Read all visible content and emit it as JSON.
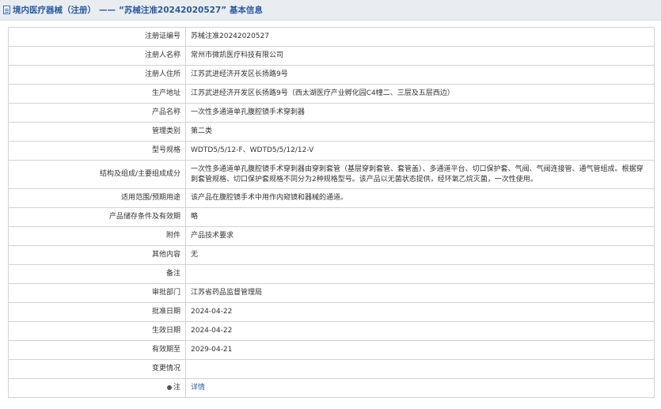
{
  "header": {
    "category": "境内医疗器械（注册）",
    "separator": "——",
    "reg_no_quoted": "“苏械注准20242020527”",
    "suffix": "基本信息"
  },
  "rows": [
    {
      "label": "注册证编号",
      "value": "苏械注准20242020527"
    },
    {
      "label": "注册人名称",
      "value": "常州市微凯医疗科技有限公司"
    },
    {
      "label": "注册人住所",
      "value": "江苏武进经济开发区长扬路9号"
    },
    {
      "label": "生产地址",
      "value": "江苏武进经济开发区长扬路9号（西太湖医疗产业孵化园C4幢二、三层及五层西边）"
    },
    {
      "label": "产品名称",
      "value": "一次性多通道单孔腹腔镜手术穿刺器"
    },
    {
      "label": "管理类别",
      "value": "第二类"
    },
    {
      "label": "型号规格",
      "value": "WDTD5/5/12-F、WDTD5/5/12/12-V"
    },
    {
      "label": "结构及组成/主要组成成分",
      "value": "一次性多通道单孔腹腔镜手术穿刺器由穿刺套管（基层穿刺套管、套管盖）、多通道平台、切口保护套、气阀、气阀连接管、通气管组成。根据穿刺套管规格、切口保护套规格不同分为2种规格型号。该产品以无菌状态提供，经环氧乙烷灭菌，一次性使用。"
    },
    {
      "label": "适用范围/预期用途",
      "value": "该产品在腹腔镜手术中用作内窥镜和器械的通道。"
    },
    {
      "label": "产品储存条件及有效期",
      "value": "略"
    },
    {
      "label": "附件",
      "value": "产品技术要求"
    },
    {
      "label": "其他内容",
      "value": "无"
    },
    {
      "label": "备注",
      "value": ""
    },
    {
      "label": "审批部门",
      "value": "江苏省药品监督管理局"
    },
    {
      "label": "批准日期",
      "value": "2024-04-22"
    },
    {
      "label": "生效日期",
      "value": "2024-04-22"
    },
    {
      "label": "有效期至",
      "value": "2029-04-21"
    },
    {
      "label": "变更情况",
      "value": ""
    }
  ],
  "note_row": {
    "label": "注",
    "link": "详情"
  }
}
